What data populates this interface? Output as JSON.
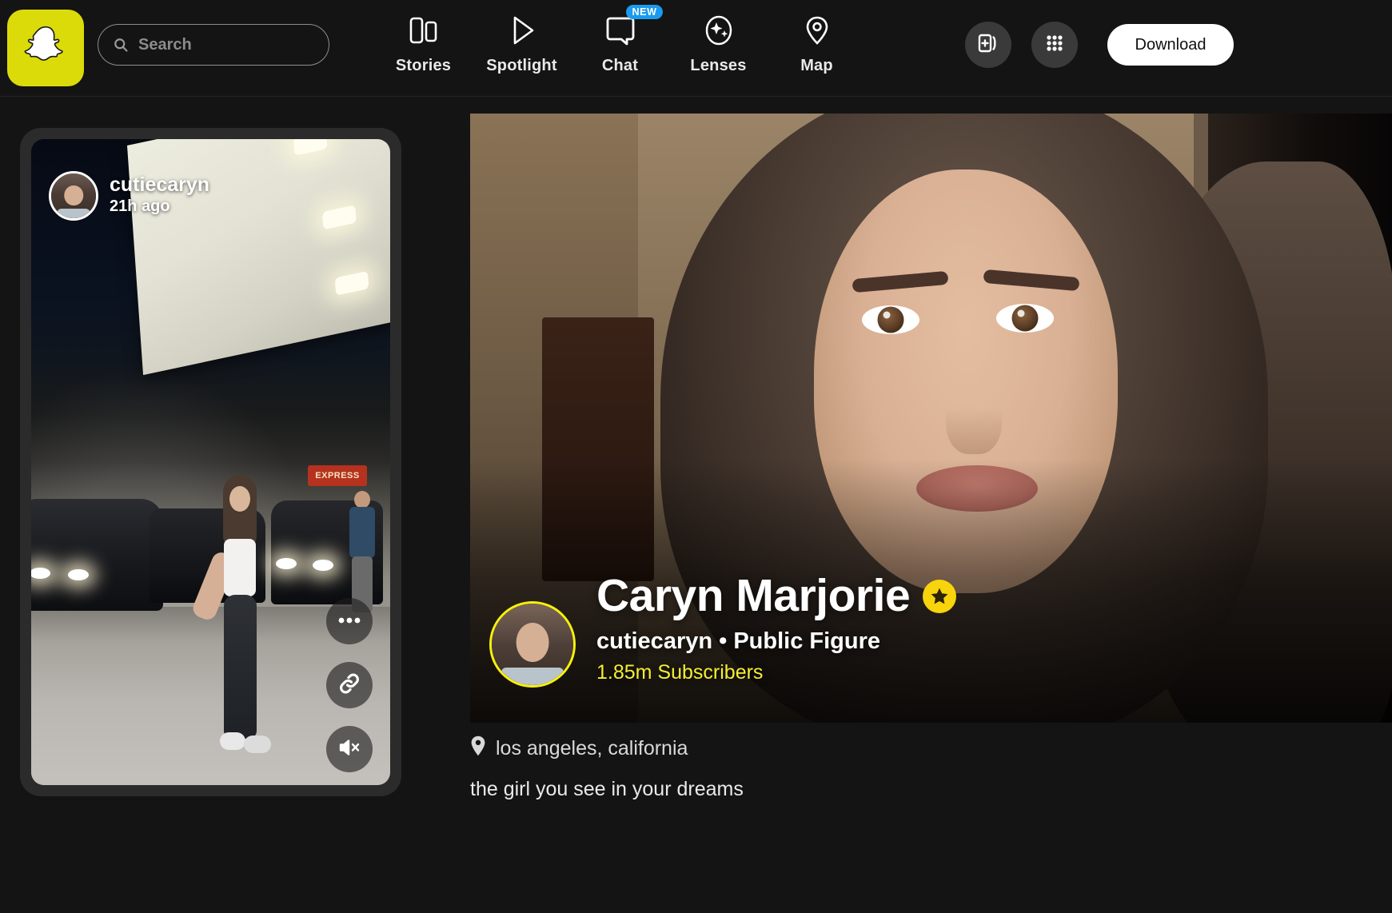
{
  "app": {
    "name": "Snapchat",
    "logo_icon": "snapchat-ghost-icon"
  },
  "search": {
    "placeholder": "Search",
    "value": "",
    "icon": "search-icon"
  },
  "nav": {
    "items": [
      {
        "label": "Stories",
        "icon": "stories-icon",
        "badge": ""
      },
      {
        "label": "Spotlight",
        "icon": "play-icon",
        "badge": ""
      },
      {
        "label": "Chat",
        "icon": "chat-bubble-icon",
        "badge": "NEW"
      },
      {
        "label": "Lenses",
        "icon": "sparkle-icon",
        "badge": ""
      },
      {
        "label": "Map",
        "icon": "map-pin-icon",
        "badge": ""
      }
    ]
  },
  "actions": {
    "add_story_icon": "add-to-story-icon",
    "grid_icon": "app-grid-icon",
    "download_label": "Download"
  },
  "story_card": {
    "username": "cutiecaryn",
    "timestamp": "21h ago",
    "avatar_icon": "story-avatar",
    "store_sign": "EXPRESS",
    "buttons": [
      {
        "name": "more-options-button",
        "icon": "ellipsis-icon"
      },
      {
        "name": "copy-link-button",
        "icon": "link-icon"
      },
      {
        "name": "mute-button",
        "icon": "speaker-muted-icon"
      }
    ]
  },
  "profile": {
    "display_name": "Caryn Marjorie",
    "verified_icon": "verified-star-badge",
    "handle": "cutiecaryn",
    "separator": "•",
    "category": "Public Figure",
    "handle_line": "cutiecaryn • Public Figure",
    "subscribers": "1.85m Subscribers",
    "location": "los angeles, california",
    "location_icon": "map-pin-icon",
    "bio": "the girl you see in your dreams"
  },
  "colors": {
    "brand_yellow": "#DCDB0A",
    "subscriber_yellow": "#F4EF32",
    "badge_blue": "#1a9bf0",
    "background": "#141414",
    "card_background": "#2b2b2b"
  }
}
